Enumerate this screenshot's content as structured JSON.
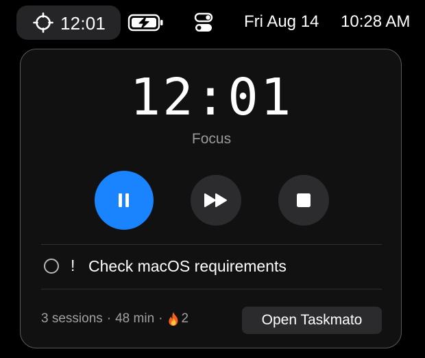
{
  "menubar": {
    "timer_icon": "timer-icon",
    "timer_time": "12:01",
    "battery_icon": "battery-charging-icon",
    "control_icon": "control-center-icon",
    "date": "Fri Aug 14",
    "clock": "10:28 AM"
  },
  "timer": {
    "time": "12:01",
    "mode": "Focus"
  },
  "controls": {
    "pause_icon": "pause-icon",
    "skip_icon": "skip-forward-icon",
    "stop_icon": "stop-icon"
  },
  "task": {
    "priority": "!",
    "title": "Check macOS requirements",
    "completed": false
  },
  "footer": {
    "sessions": "3 sessions",
    "separator": "·",
    "minutes": "48 min",
    "streak": "2",
    "streak_icon": "flame-icon",
    "open_button": "Open Taskmato"
  },
  "colors": {
    "accent": "#1a84ff",
    "panel_bg": "#111112",
    "panel_border": "#5b5b5e",
    "secondary_button": "#2c2c2e",
    "muted_text": "#a1a1a3"
  }
}
